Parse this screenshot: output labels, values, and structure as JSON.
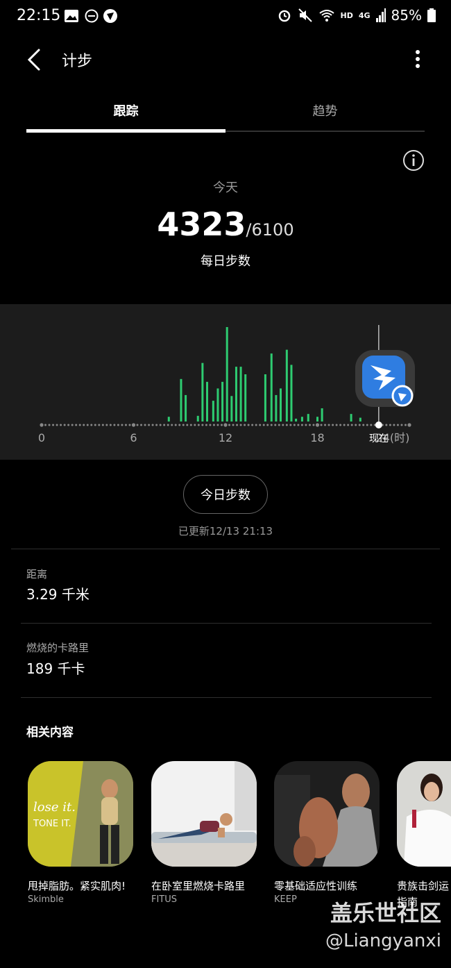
{
  "status_bar": {
    "time": "22:15",
    "hd": "HD",
    "signal": "4G",
    "battery": "85%"
  },
  "header": {
    "title": "计步"
  },
  "tabs": [
    {
      "label": "跟踪",
      "active": true
    },
    {
      "label": "趋势",
      "active": false
    }
  ],
  "summary": {
    "day_label": "今天",
    "steps": "4323",
    "goal": "/6100",
    "caption": "每日步数"
  },
  "chart_data": {
    "type": "bar",
    "x_ticks": [
      "0",
      "6",
      "12",
      "18",
      "24(时)"
    ],
    "now_label": "现在",
    "now_hour": 22,
    "x_range": [
      0,
      24
    ],
    "bars_hour": [
      8.3,
      9.1,
      9.4,
      10.2,
      10.5,
      10.8,
      11.2,
      11.5,
      11.8,
      12.1,
      12.4,
      12.7,
      13.0,
      13.3,
      14.6,
      15.0,
      15.3,
      15.6,
      16.0,
      16.3,
      16.6,
      17.0,
      17.4,
      18.0,
      18.3,
      20.2,
      20.8
    ],
    "bars_value": [
      0.05,
      0.45,
      0.28,
      0.06,
      0.62,
      0.42,
      0.22,
      0.35,
      0.42,
      1.0,
      0.27,
      0.58,
      0.58,
      0.5,
      0.5,
      0.72,
      0.28,
      0.35,
      0.76,
      0.6,
      0.03,
      0.05,
      0.08,
      0.05,
      0.14,
      0.08,
      0.04
    ],
    "bar_color": "#2ecc71",
    "grid": false
  },
  "actions": {
    "today_steps_button": "今日步数",
    "updated": "已更新12/13 21:13"
  },
  "stats": [
    {
      "label": "距离",
      "value": "3.29 千米"
    },
    {
      "label": "燃烧的卡路里",
      "value": "189 千卡"
    }
  ],
  "related": {
    "heading": "相关内容",
    "cards": [
      {
        "title": "甩掉脂肪。紧实肌肉!",
        "source": "Skimble",
        "art_text_1": "lose it.",
        "art_text_2": "TONE IT."
      },
      {
        "title": "在卧室里燃烧卡路里",
        "source": "FITUS"
      },
      {
        "title": "零基础适应性训练",
        "source": "KEEP"
      },
      {
        "title": "贵族击剑运",
        "source": "指南"
      }
    ]
  },
  "watermark": {
    "line1": "盖乐世社区",
    "line2": "@Liangyanxi"
  },
  "colors": {
    "accent": "#2ecc71",
    "app_badge": "#2f7de1"
  }
}
